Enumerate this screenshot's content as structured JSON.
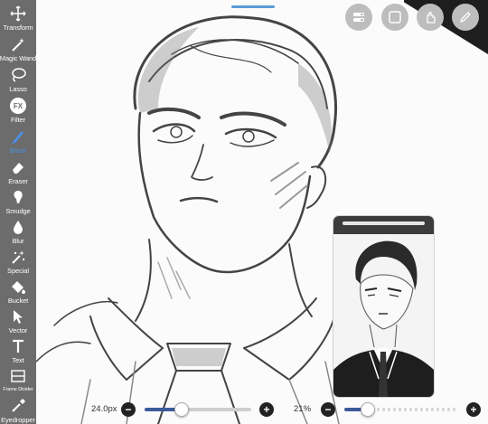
{
  "toolbar": {
    "tools": [
      {
        "label": "Transform",
        "icon": "transform-icon"
      },
      {
        "label": "Magic Wand",
        "icon": "magic-wand-icon"
      },
      {
        "label": "Lasso",
        "icon": "lasso-icon"
      },
      {
        "label": "Filter",
        "icon": "fx-icon",
        "icon_text": "FX"
      },
      {
        "label": "Brush",
        "icon": "brush-icon",
        "active": true
      },
      {
        "label": "Eraser",
        "icon": "eraser-icon"
      },
      {
        "label": "Smudge",
        "icon": "smudge-icon"
      },
      {
        "label": "Blur",
        "icon": "blur-icon"
      },
      {
        "label": "Special",
        "icon": "special-icon"
      },
      {
        "label": "Bucket",
        "icon": "bucket-icon"
      },
      {
        "label": "Vector",
        "icon": "vector-icon"
      },
      {
        "label": "Text",
        "icon": "text-icon"
      },
      {
        "label": "Frame Divider",
        "icon": "frame-divider-icon"
      },
      {
        "label": "Eyedropper",
        "icon": "eyedropper-icon"
      }
    ]
  },
  "top_buttons": [
    {
      "icon": "layers-icon"
    },
    {
      "icon": "square-icon"
    },
    {
      "icon": "hand-icon"
    },
    {
      "icon": "pen-icon"
    }
  ],
  "brush_size": {
    "value_label": "24.0px",
    "level": 0.35
  },
  "opacity": {
    "value_label": "21%",
    "level": 0.21
  },
  "colors": {
    "toolbar_bg": "#6c6c6c",
    "accent": "#4a90e2",
    "slider_track": "#3b5b9a"
  }
}
